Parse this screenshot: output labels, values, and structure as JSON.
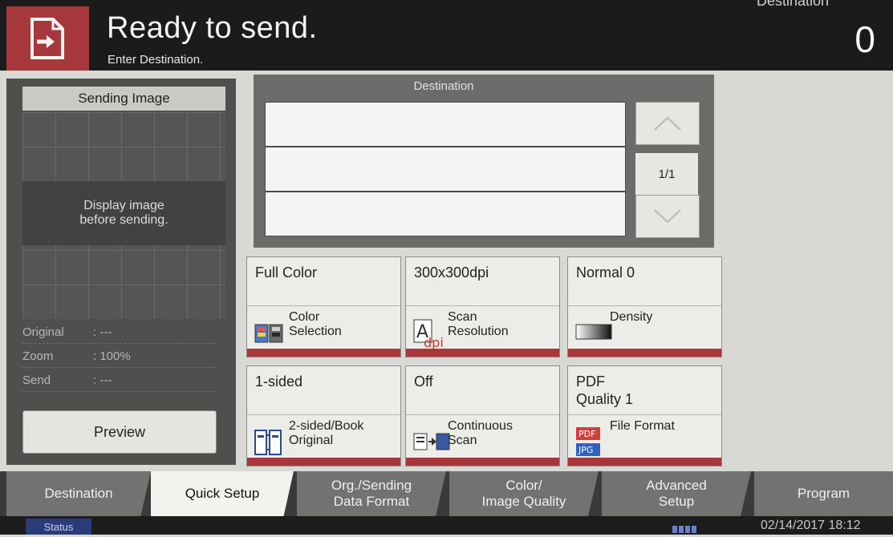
{
  "header": {
    "title": "Ready to send.",
    "subtitle": "Enter Destination.",
    "dest_count_label": "Destination",
    "dest_count": "0",
    "accent_color": "#a6383c"
  },
  "preview": {
    "title": "Sending Image",
    "message_line1": "Display image",
    "message_line2": "before sending.",
    "info": [
      {
        "key": "Original",
        "value": ": ---"
      },
      {
        "key": "Zoom",
        "value": ": 100%"
      },
      {
        "key": "Send",
        "value": ": ---"
      }
    ],
    "preview_button": "Preview"
  },
  "destination": {
    "label": "Destination",
    "page_indicator": "1/1"
  },
  "tiles": [
    {
      "value": "Full Color",
      "label1": "Color",
      "label2": "Selection",
      "icon": "color-selection-icon"
    },
    {
      "value": "300x300dpi",
      "label1": "Scan",
      "label2": "Resolution",
      "icon": "dpi-icon"
    },
    {
      "value": "Normal 0",
      "label1": "Density",
      "label2": "",
      "icon": "density-icon"
    },
    {
      "value": "1-sided",
      "label1": "2-sided/Book",
      "label2": "Original",
      "icon": "duplex-icon"
    },
    {
      "value": "Off",
      "label1": "Continuous",
      "label2": "Scan",
      "icon": "continuous-scan-icon"
    },
    {
      "value": "PDF",
      "value2": "Quality 1",
      "label1": "File Format",
      "label2": "",
      "icon": "file-format-icon",
      "icon_text1": "PDF",
      "icon_text2": "JPG"
    }
  ],
  "tabs": [
    {
      "line1": "Destination",
      "line2": ""
    },
    {
      "line1": "Quick Setup",
      "line2": ""
    },
    {
      "line1": "Org./Sending",
      "line2": "Data Format"
    },
    {
      "line1": "Color/",
      "line2": "Image Quality"
    },
    {
      "line1": "Advanced",
      "line2": "Setup"
    },
    {
      "line1": "Program",
      "line2": ""
    }
  ],
  "status": {
    "label": "Status",
    "datetime": "02/14/2017 18:12"
  }
}
